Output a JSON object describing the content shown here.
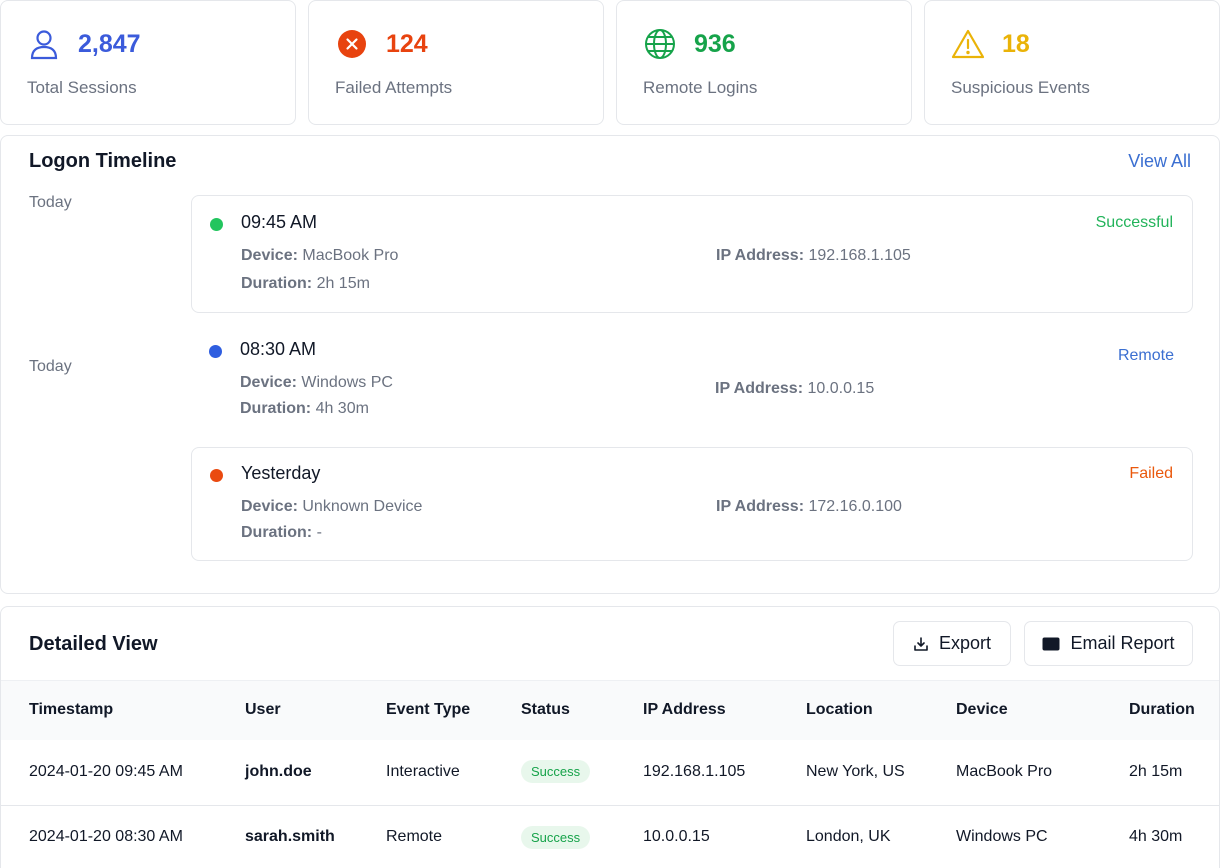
{
  "stats": [
    {
      "value": "2,847",
      "label": "Total Sessions",
      "icon": "user-icon",
      "color": "#3b5bdb"
    },
    {
      "value": "124",
      "label": "Failed Attempts",
      "icon": "x-circle-icon",
      "color": "#e8430f"
    },
    {
      "value": "936",
      "label": "Remote Logins",
      "icon": "globe-icon",
      "color": "#16a34a"
    },
    {
      "value": "18",
      "label": "Suspicious Events",
      "icon": "warning-icon",
      "color": "#eab308"
    }
  ],
  "timeline": {
    "title": "Logon Timeline",
    "view_all": "View All",
    "day_labels": [
      "Today",
      "Today"
    ],
    "entries": [
      {
        "time": "09:45 AM",
        "status": "Successful",
        "status_color": "#22b35a",
        "dot_color": "#22c55e",
        "device_label": "Device:",
        "device": "MacBook Pro",
        "duration_label": "Duration:",
        "duration": "2h 15m",
        "ip_label": "IP Address:",
        "ip": "192.168.1.105"
      },
      {
        "time": "08:30 AM",
        "status": "Remote",
        "status_color": "#3b6fd1",
        "dot_color": "#2f5ee0",
        "device_label": "Device:",
        "device": "Windows PC",
        "duration_label": "Duration:",
        "duration": "4h 30m",
        "ip_label": "IP Address:",
        "ip": "10.0.0.15"
      },
      {
        "time": "Yesterday",
        "status": "Failed",
        "status_color": "#ea580c",
        "dot_color": "#ea4a10",
        "device_label": "Device:",
        "device": "Unknown Device",
        "duration_label": "Duration:",
        "duration": "-",
        "ip_label": "IP Address:",
        "ip": "172.16.0.100"
      }
    ]
  },
  "detailed": {
    "title": "Detailed View",
    "export_label": "Export",
    "email_label": "Email Report",
    "columns": [
      "Timestamp",
      "User",
      "Event Type",
      "Status",
      "IP Address",
      "Location",
      "Device",
      "Duration"
    ],
    "rows": [
      [
        "2024-01-20 09:45 AM",
        "john.doe",
        "Interactive",
        "Success",
        "192.168.1.105",
        "New York, US",
        "MacBook Pro",
        "2h 15m"
      ],
      [
        "2024-01-20 08:30 AM",
        "sarah.smith",
        "Remote",
        "Success",
        "10.0.0.15",
        "London, UK",
        "Windows PC",
        "4h 30m"
      ]
    ]
  }
}
